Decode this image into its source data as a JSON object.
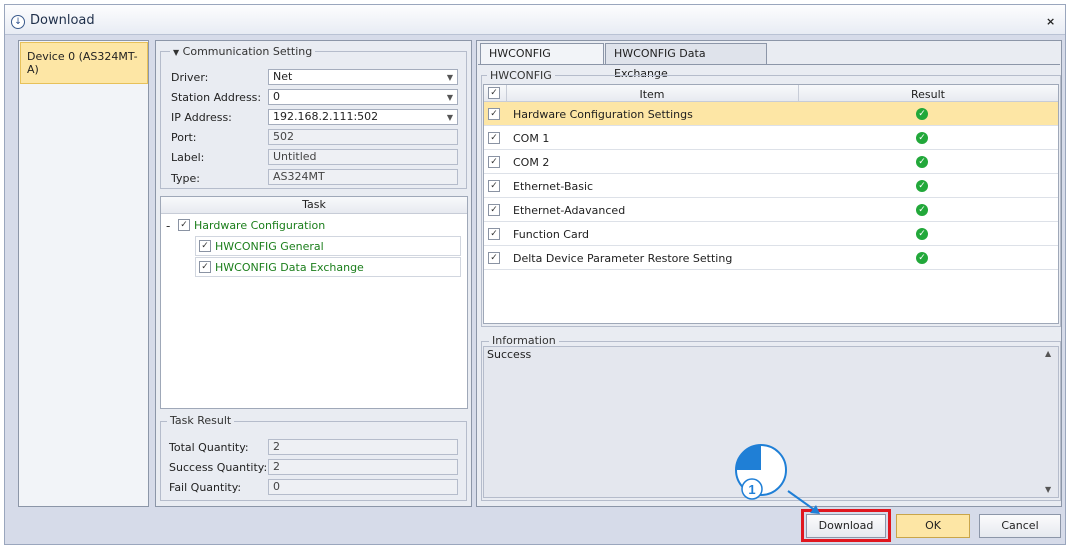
{
  "window": {
    "title": "Download"
  },
  "device": {
    "label": "Device 0 (AS324MT-A)"
  },
  "communication": {
    "legend": "Communication Setting",
    "driver": {
      "label": "Driver:",
      "value": "Net"
    },
    "station": {
      "label": "Station Address:",
      "value": "0"
    },
    "ip": {
      "label": "IP Address:",
      "value": "192.168.2.111:502"
    },
    "port": {
      "label": "Port:",
      "value": "502"
    },
    "label_field": {
      "label": "Label:",
      "value": "Untitled"
    },
    "type": {
      "label": "Type:",
      "value": "AS324MT"
    }
  },
  "task": {
    "header": "Task",
    "collapse": "-",
    "items": [
      {
        "label": "Hardware Configuration",
        "checked": true,
        "level": 0
      },
      {
        "label": "HWCONFIG General",
        "checked": true,
        "level": 1
      },
      {
        "label": "HWCONFIG Data Exchange",
        "checked": true,
        "level": 1
      }
    ]
  },
  "task_result": {
    "legend": "Task Result",
    "total": {
      "label": "Total Quantity:",
      "value": "2"
    },
    "success": {
      "label": "Success Quantity:",
      "value": "2"
    },
    "fail": {
      "label": "Fail Quantity:",
      "value": "0"
    }
  },
  "tabs": [
    {
      "label": "HWCONFIG General",
      "active": true
    },
    {
      "label": "HWCONFIG Data Exchange",
      "active": false
    }
  ],
  "hwconfig": {
    "legend": "HWCONFIG",
    "col_item": "Item",
    "col_result": "Result",
    "rows": [
      {
        "item": "Hardware Configuration Settings",
        "selected": true
      },
      {
        "item": "COM 1",
        "selected": false
      },
      {
        "item": "COM 2",
        "selected": false
      },
      {
        "item": "Ethernet-Basic",
        "selected": false
      },
      {
        "item": "Ethernet-Adavanced",
        "selected": false
      },
      {
        "item": "Function Card",
        "selected": false
      },
      {
        "item": "Delta Device Parameter Restore Setting",
        "selected": false
      }
    ]
  },
  "information": {
    "legend": "Information",
    "text": "Success"
  },
  "buttons": {
    "download": "Download",
    "ok": "OK",
    "cancel": "Cancel"
  },
  "annotation": {
    "number": "1",
    "highlight_color": "#e0161e",
    "marker_color": "#1f7fd6"
  },
  "colors": {
    "selected_row": "#fde6a5",
    "success": "#22a83a",
    "task_text": "#1b7e1b"
  },
  "icons": {
    "title": "download-circle-icon",
    "result": "check-circle-icon",
    "close": "close-icon"
  }
}
